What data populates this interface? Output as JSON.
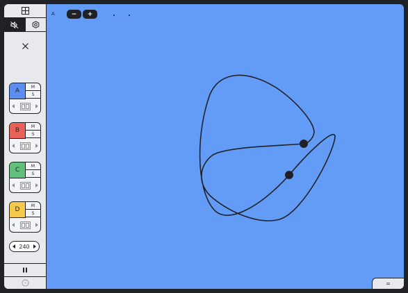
{
  "sidebar": {
    "tracks": [
      {
        "label": "A",
        "color": "#5b8ef0",
        "mute": "M",
        "solo": "S"
      },
      {
        "label": "B",
        "color": "#e9625a",
        "mute": "M",
        "solo": "S"
      },
      {
        "label": "C",
        "color": "#5fbf7b",
        "mute": "M",
        "solo": "S"
      },
      {
        "label": "D",
        "color": "#f7c94a",
        "mute": "M",
        "solo": "S"
      }
    ],
    "tempo": "240"
  },
  "canvas": {
    "corner_label": "A",
    "zoom_out": "−",
    "zoom_in": "+",
    "background": "#639cf7"
  },
  "bottom_right_button": "="
}
